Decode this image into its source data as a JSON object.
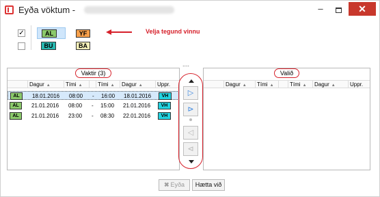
{
  "window": {
    "title": "Eyða vöktum -",
    "min_label": "–",
    "close_label": "✕",
    "icons": [
      "app-icon",
      "minimize-icon",
      "maximize-icon",
      "close-icon"
    ]
  },
  "filters": {
    "rows": [
      {
        "checked": true,
        "check_mark": "✓",
        "tags": [
          "AL",
          "YF"
        ]
      },
      {
        "checked": false,
        "check_mark": "",
        "tags": [
          "BU",
          "BA"
        ]
      }
    ],
    "hint": "Velja tegund vinnu"
  },
  "dots": "....",
  "left_panel": {
    "title": "Vaktir (3)",
    "columns": [
      "",
      "Dagur",
      "Tími",
      "",
      "Tími",
      "Dagur",
      "Uppr."
    ],
    "rows": [
      {
        "tag": "AL",
        "date1": "18.01.2016",
        "time1": "08:00",
        "dash": "-",
        "time2": "16:00",
        "date2": "18.01.2016",
        "uppr": "VH"
      },
      {
        "tag": "AL",
        "date1": "21.01.2016",
        "time1": "08:00",
        "dash": "-",
        "time2": "15:00",
        "date2": "21.01.2016",
        "uppr": "VH"
      },
      {
        "tag": "AL",
        "date1": "21.01.2016",
        "time1": "23:00",
        "dash": "-",
        "time2": "08:30",
        "date2": "22.01.2016",
        "uppr": "VH"
      }
    ]
  },
  "right_panel": {
    "title": "Valið",
    "columns": [
      "Dagur",
      "Tími",
      "Tími",
      "Dagur",
      "Uppr."
    ]
  },
  "middle": {
    "icons": [
      "scroll-up-icon",
      "move-right-icon",
      "move-all-right-icon",
      "move-left-icon",
      "move-all-left-icon",
      "scroll-down-icon"
    ],
    "labels": {
      "right": "▷",
      "all_right": "⊳",
      "left": "◁",
      "all_left": "⊲"
    }
  },
  "buttons": {
    "delete": "Eyða",
    "cancel": "Hætta við"
  },
  "colors": {
    "al": "#8bc96b",
    "yf": "#f7a04b",
    "bu": "#27b8b0",
    "ba": "#f4efb8",
    "vh": "#22d3e0",
    "close": "#c8382c",
    "annotation": "#d6202a"
  }
}
